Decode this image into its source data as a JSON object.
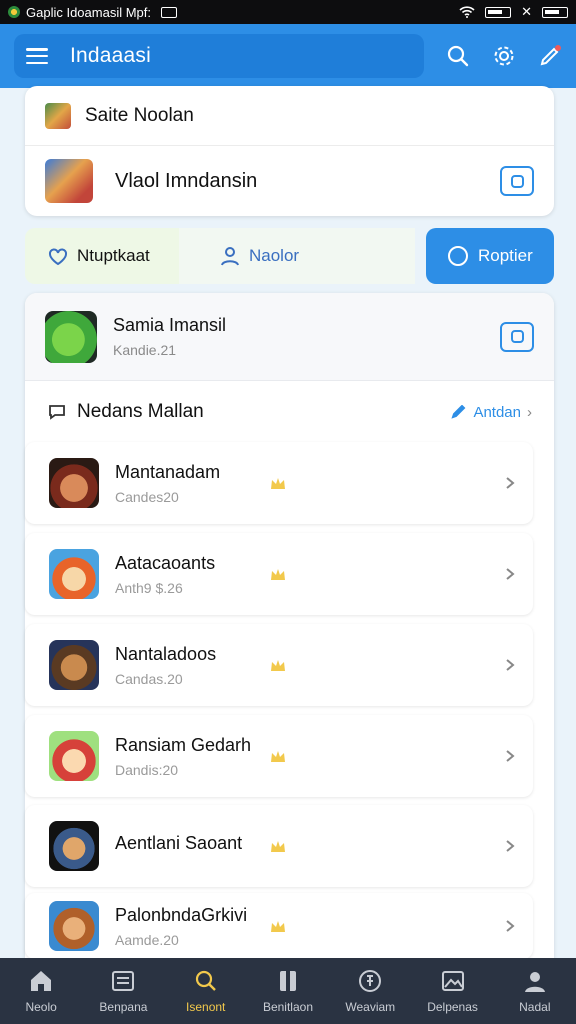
{
  "status_bar": {
    "app_name": "Gaplic Idoamasil Mpf:"
  },
  "app_bar": {
    "title": "Indaaasi"
  },
  "top_card": {
    "row1_label": "Saite Noolan",
    "row2_label": "Vlaol Imndansin"
  },
  "tabs": [
    {
      "label": "Ntuptkaat"
    },
    {
      "label": "Naolor"
    },
    {
      "label": "Roptier"
    }
  ],
  "featured": {
    "title": "Samia Imansil",
    "subtitle": "Kandie.21"
  },
  "section": {
    "title": "Nedans Mallan",
    "link": "Antdan"
  },
  "list_items": [
    {
      "title": "Mantanadam",
      "subtitle": "Candes20"
    },
    {
      "title": "Aatacaoants",
      "subtitle": "Anth9 $.26"
    },
    {
      "title": "Nantaladoos",
      "subtitle": "Candas.20"
    },
    {
      "title": "Ransiam Gedarh",
      "subtitle": "Dandis:20"
    },
    {
      "title": "Aentlani Saoant",
      "subtitle": ""
    },
    {
      "title": "PalonbndaGrkivi",
      "subtitle": "Aamde.20"
    }
  ],
  "bottom_nav": [
    {
      "label": "Neolo",
      "icon": "home-icon"
    },
    {
      "label": "Benpana",
      "icon": "list-icon"
    },
    {
      "label": "Isenont",
      "icon": "search-icon"
    },
    {
      "label": "Benitlaon",
      "icon": "book-icon"
    },
    {
      "label": "Weaviam",
      "icon": "coin-icon"
    },
    {
      "label": "Delpenas",
      "icon": "image-icon"
    },
    {
      "label": "Nadal",
      "icon": "person-icon"
    }
  ],
  "colors": {
    "accent": "#2d8ee6",
    "nav_bg": "#2a3342",
    "nav_active": "#f2c94c",
    "badge": "#f2c94c"
  }
}
